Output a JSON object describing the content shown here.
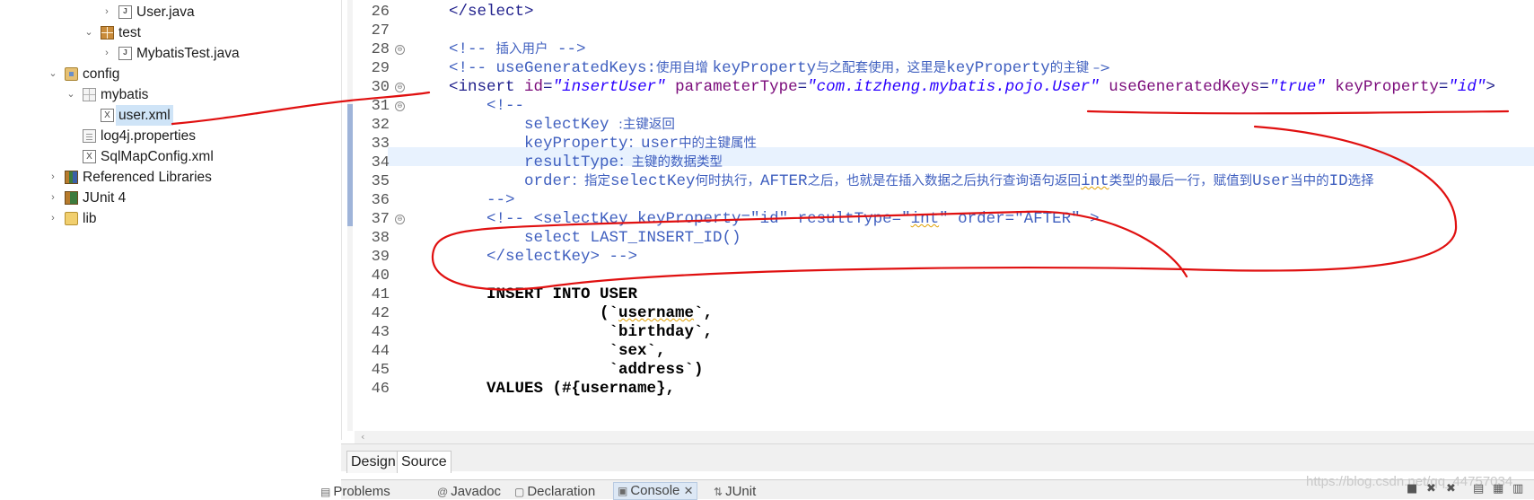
{
  "explorer": {
    "items": [
      {
        "label": "User.java",
        "twisty": "›",
        "icon": "java-file-icon"
      },
      {
        "label": "test",
        "twisty": "⌄",
        "icon": "package-icon"
      },
      {
        "label": "MybatisTest.java",
        "twisty": "›",
        "icon": "java-file-icon"
      },
      {
        "label": "config",
        "twisty": "⌄",
        "icon": "source-folder-icon"
      },
      {
        "label": "mybatis",
        "twisty": "⌄",
        "icon": "empty-package-icon"
      },
      {
        "label": "user.xml",
        "twisty": "",
        "icon": "xml-file-icon",
        "selected": true
      },
      {
        "label": "log4j.properties",
        "twisty": "",
        "icon": "properties-file-icon"
      },
      {
        "label": "SqlMapConfig.xml",
        "twisty": "",
        "icon": "xml-file-icon"
      },
      {
        "label": "Referenced Libraries",
        "twisty": "›",
        "icon": "library-icon"
      },
      {
        "label": "JUnit 4",
        "twisty": "›",
        "icon": "junit-library-icon"
      },
      {
        "label": "lib",
        "twisty": "›",
        "icon": "folder-icon"
      }
    ]
  },
  "editor": {
    "line_numbers": [
      "26",
      "27",
      "28",
      "29",
      "30",
      "31",
      "32",
      "33",
      "34",
      "35",
      "36",
      "37",
      "38",
      "39",
      "40",
      "41",
      "42",
      "43",
      "44",
      "45",
      "46"
    ],
    "folds": {
      "28": "⊖",
      "30": "⊖",
      "31": "⊖",
      "37": "⊖"
    },
    "lines": [
      {
        "n": "26",
        "parts": [
          [
            "c-tag",
            "    </select>"
          ]
        ]
      },
      {
        "n": "27",
        "parts": []
      },
      {
        "n": "28",
        "parts": [
          [
            "c-com",
            "    <!-- "
          ],
          [
            "c-com cjk",
            "插入用户"
          ],
          [
            "c-com",
            " -->"
          ]
        ]
      },
      {
        "n": "29",
        "parts": [
          [
            "c-com",
            "    <!-- useGeneratedKeys:"
          ],
          [
            "c-com cjk",
            "使用自增 "
          ],
          [
            "c-com",
            "keyProperty"
          ],
          [
            "c-com cjk",
            "与之配套使用，这里是"
          ],
          [
            "c-com",
            "keyProperty"
          ],
          [
            "c-com cjk",
            "的主键 –>"
          ]
        ]
      },
      {
        "n": "30",
        "parts": [
          [
            "c-tag",
            "    <insert "
          ],
          [
            "c-attr",
            "id"
          ],
          [
            "c-tag",
            "="
          ],
          [
            "c-val",
            "\"insertUser\""
          ],
          [
            "c-tag",
            " "
          ],
          [
            "c-attr",
            "parameterType"
          ],
          [
            "c-tag",
            "="
          ],
          [
            "c-val",
            "\"com.itzheng.mybatis.pojo.User\""
          ],
          [
            "c-tag",
            " "
          ],
          [
            "c-attr",
            "useGeneratedKeys"
          ],
          [
            "c-tag",
            "="
          ],
          [
            "c-val",
            "\"true\""
          ],
          [
            "c-tag",
            " "
          ],
          [
            "c-attr",
            "keyProperty"
          ],
          [
            "c-tag",
            "="
          ],
          [
            "c-val",
            "\"id\""
          ],
          [
            "c-tag",
            ">"
          ]
        ]
      },
      {
        "n": "31",
        "parts": [
          [
            "c-com",
            "        <!--"
          ]
        ]
      },
      {
        "n": "32",
        "parts": [
          [
            "c-com",
            "            selectKey "
          ],
          [
            "c-com cjk",
            ":主键返回"
          ]
        ]
      },
      {
        "n": "33",
        "parts": [
          [
            "c-com",
            "            keyProperty"
          ],
          [
            "c-com cjk",
            "："
          ],
          [
            "c-com",
            "user"
          ],
          [
            "c-com cjk",
            "中的主键属性"
          ]
        ]
      },
      {
        "n": "34",
        "parts": [
          [
            "c-com",
            "            resultType"
          ],
          [
            "c-com cjk",
            "：主键的数据类型"
          ]
        ]
      },
      {
        "n": "35",
        "parts": [
          [
            "c-com",
            "            order"
          ],
          [
            "c-com cjk",
            "：指定"
          ],
          [
            "c-com",
            "selectKey"
          ],
          [
            "c-com cjk",
            "何时执行，"
          ],
          [
            "c-com",
            "AFTER"
          ],
          [
            "c-com cjk",
            "之后，也就是在插入数据之后执行查询语句返回"
          ],
          [
            "c-com sq",
            "int"
          ],
          [
            "c-com cjk",
            "类型的最后一行，赋值到"
          ],
          [
            "c-com",
            "User"
          ],
          [
            "c-com cjk",
            "当中的"
          ],
          [
            "c-com",
            "ID"
          ],
          [
            "c-com cjk",
            "选择"
          ]
        ]
      },
      {
        "n": "36",
        "parts": [
          [
            "c-com",
            "        -->"
          ]
        ]
      },
      {
        "n": "37",
        "parts": [
          [
            "c-com",
            "        <!-- <selectKey keyProperty=\"id\" resultType=\""
          ],
          [
            "c-com sq",
            "int"
          ],
          [
            "c-com",
            "\" order=\"AFTER\" >"
          ]
        ]
      },
      {
        "n": "38",
        "parts": [
          [
            "c-com",
            "            select LAST_INSERT_ID()"
          ]
        ]
      },
      {
        "n": "39",
        "parts": [
          [
            "c-com",
            "        </selectKey> -->"
          ]
        ]
      },
      {
        "n": "40",
        "parts": []
      },
      {
        "n": "41",
        "parts": [
          [
            "c-sql",
            "        INSERT INTO USER"
          ]
        ]
      },
      {
        "n": "42",
        "parts": [
          [
            "c-sql",
            "                    (`"
          ],
          [
            "c-sql sq",
            "username"
          ],
          [
            "c-sql",
            "`,"
          ]
        ]
      },
      {
        "n": "43",
        "parts": [
          [
            "c-sql",
            "                     `birthday`,"
          ]
        ]
      },
      {
        "n": "44",
        "parts": [
          [
            "c-sql",
            "                     `sex`,"
          ]
        ]
      },
      {
        "n": "45",
        "parts": [
          [
            "c-sql",
            "                     `address`)"
          ]
        ]
      },
      {
        "n": "46",
        "parts": [
          [
            "c-sql",
            "        VALUES (#{username},"
          ]
        ]
      }
    ],
    "tabs": {
      "design": "Design",
      "source": "Source"
    }
  },
  "views": {
    "problems": "Problems",
    "javadoc": "Javadoc",
    "declaration": "Declaration",
    "console": "Console",
    "junit": "JUnit",
    "watermark": "https://blog.csdn.net/qq_44757034"
  },
  "colors": {
    "annotation": "#e01010",
    "selection": "#cfe4f7",
    "current_line": "#e8f2fe",
    "comment": "#3f5fbf",
    "tag": "#20208c",
    "attribute": "#7a0a7a",
    "string": "#2a00ff"
  }
}
